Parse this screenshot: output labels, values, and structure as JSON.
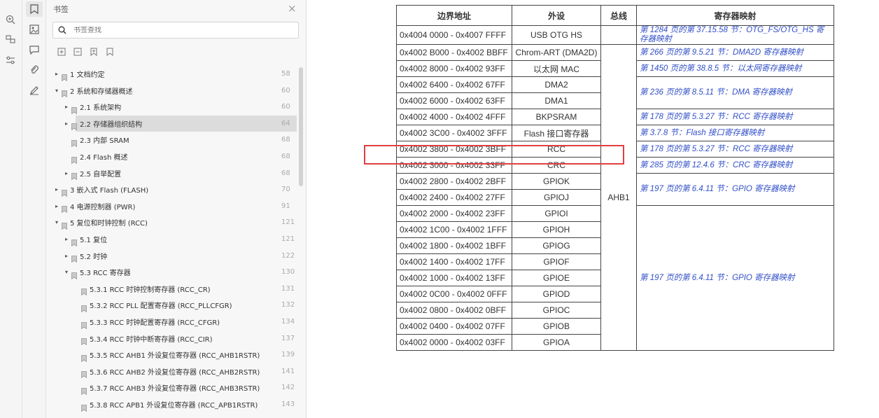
{
  "panel": {
    "title": "书签",
    "search_placeholder": "书签查找"
  },
  "bookmarks": [
    {
      "label": "1 文档约定",
      "page": "58",
      "level": 0,
      "arrow": "▸"
    },
    {
      "label": "2 系统和存储器概述",
      "page": "60",
      "level": 0,
      "arrow": "▾"
    },
    {
      "label": "2.1 系统架构",
      "page": "60",
      "level": 1,
      "arrow": "▸"
    },
    {
      "label": "2.2 存储器组织结构",
      "page": "64",
      "level": 1,
      "arrow": "▸",
      "selected": true
    },
    {
      "label": "2.3 内部 SRAM",
      "page": "68",
      "level": 1,
      "arrow": ""
    },
    {
      "label": "2.4 Flash 概述",
      "page": "68",
      "level": 1,
      "arrow": ""
    },
    {
      "label": "2.5 自举配置",
      "page": "68",
      "level": 1,
      "arrow": "▸"
    },
    {
      "label": "3 嵌入式 Flash (FLASH)",
      "page": "70",
      "level": 0,
      "arrow": "▸"
    },
    {
      "label": "4 电源控制器 (PWR)",
      "page": "91",
      "level": 0,
      "arrow": "▸"
    },
    {
      "label": "5 复位和时钟控制 (RCC)",
      "page": "121",
      "level": 0,
      "arrow": "▾"
    },
    {
      "label": "5.1 复位",
      "page": "121",
      "level": 1,
      "arrow": "▸"
    },
    {
      "label": "5.2 时钟",
      "page": "122",
      "level": 1,
      "arrow": "▸"
    },
    {
      "label": "5.3 RCC 寄存器",
      "page": "130",
      "level": 1,
      "arrow": "▾"
    },
    {
      "label": "5.3.1 RCC 时钟控制寄存器 (RCC_CR)",
      "page": "131",
      "level": 2,
      "arrow": ""
    },
    {
      "label": "5.3.2 RCC PLL 配置寄存器 (RCC_PLLCFGR)",
      "page": "132",
      "level": 2,
      "arrow": ""
    },
    {
      "label": "5.3.3 RCC 时钟配置寄存器 (RCC_CFGR)",
      "page": "134",
      "level": 2,
      "arrow": ""
    },
    {
      "label": "5.3.4 RCC 时钟中断寄存器 (RCC_CIR)",
      "page": "137",
      "level": 2,
      "arrow": ""
    },
    {
      "label": "5.3.5 RCC AHB1 外设复位寄存器 (RCC_AHB1RSTR)",
      "page": "139",
      "level": 2,
      "arrow": ""
    },
    {
      "label": "5.3.6 RCC AHB2 外设复位寄存器 (RCC_AHB2RSTR)",
      "page": "141",
      "level": 2,
      "arrow": ""
    },
    {
      "label": "5.3.7 RCC AHB3 外设复位寄存器 (RCC_AHB3RSTR)",
      "page": "142",
      "level": 2,
      "arrow": ""
    },
    {
      "label": "5.3.8 RCC APB1 外设复位寄存器 (RCC_APB1RSTR)",
      "page": "143",
      "level": 2,
      "arrow": ""
    }
  ],
  "table": {
    "caption": "",
    "headers": [
      "边界地址",
      "外设",
      "总线",
      "寄存器映射"
    ],
    "bus": "AHB1",
    "rows": [
      {
        "addr": "0x4004 0000 - 0x4007 FFFF",
        "per": "USB OTG HS"
      },
      {
        "addr": "0x4002 B000 - 0x4002 BBFF",
        "per": "Chrom-ART (DMA2D)"
      },
      {
        "addr": "0x4002 8000 - 0x4002 93FF",
        "per": "以太网 MAC"
      },
      {
        "addr": "0x4002 6400 - 0x4002 67FF",
        "per": "DMA2"
      },
      {
        "addr": "0x4002 6000 - 0x4002 63FF",
        "per": "DMA1"
      },
      {
        "addr": "0x4002 4000 - 0x4002 4FFF",
        "per": "BKPSRAM"
      },
      {
        "addr": "0x4002 3C00 - 0x4002 3FFF",
        "per": "Flash 接口寄存器"
      },
      {
        "addr": "0x4002 3800 - 0x4002 3BFF",
        "per": "RCC"
      },
      {
        "addr": "0x4002 3000 - 0x4002 33FF",
        "per": "CRC"
      },
      {
        "addr": "0x4002 2800 - 0x4002 2BFF",
        "per": "GPIOK"
      },
      {
        "addr": "0x4002 2400 - 0x4002 27FF",
        "per": "GPIOJ"
      },
      {
        "addr": "0x4002 2000 - 0x4002 23FF",
        "per": "GPIOI"
      },
      {
        "addr": "0x4002 1C00 - 0x4002 1FFF",
        "per": "GPIOH"
      },
      {
        "addr": "0x4002 1800 - 0x4002 1BFF",
        "per": "GPIOG"
      },
      {
        "addr": "0x4002 1400 - 0x4002 17FF",
        "per": "GPIOF"
      },
      {
        "addr": "0x4002 1000 - 0x4002 13FF",
        "per": "GPIOE"
      },
      {
        "addr": "0x4002 0C00 - 0x4002 0FFF",
        "per": "GPIOD"
      },
      {
        "addr": "0x4002 0800 - 0x4002 0BFF",
        "per": "GPIOC"
      },
      {
        "addr": "0x4002 0400 - 0x4002 07FF",
        "per": "GPIOB"
      },
      {
        "addr": "0x4002 0000 - 0x4002 03FF",
        "per": "GPIOA"
      }
    ],
    "maps": [
      {
        "text": "第 1284 页的第 37.15.58 节：OTG_FS/OTG_HS 寄存器映射",
        "span": 1
      },
      {
        "text": "第 266 页的第 9.5.21 节：DMA2D 寄存器映射",
        "span": 1
      },
      {
        "text": "第 1450 页的第 38.8.5 节：以太网寄存器映射",
        "span": 1
      },
      {
        "text": "第 236 页的第 8.5.11 节：DMA 寄存器映射",
        "span": 2
      },
      {
        "text": "第 178 页的第 5.3.27 节：RCC 寄存器映射",
        "span": 1
      },
      {
        "text": "第 3.7.8 节：Flash 接口寄存器映射",
        "span": 1
      },
      {
        "text": "第 178 页的第 5.3.27 节：RCC 寄存器映射",
        "span": 1
      },
      {
        "text": "第 285 页的第 12.4.6 节：CRC 寄存器映射",
        "span": 1
      },
      {
        "text": "第 197 页的第 6.4.11 节：GPIO 寄存器映射",
        "span": 2
      },
      {
        "text": "第 197 页的第 6.4.11 节：GPIO 寄存器映射",
        "span": 9
      }
    ]
  },
  "colors": {
    "link": "#3350c8",
    "highlight_box": "#e04040",
    "selected_row": "#dcdcdc"
  }
}
